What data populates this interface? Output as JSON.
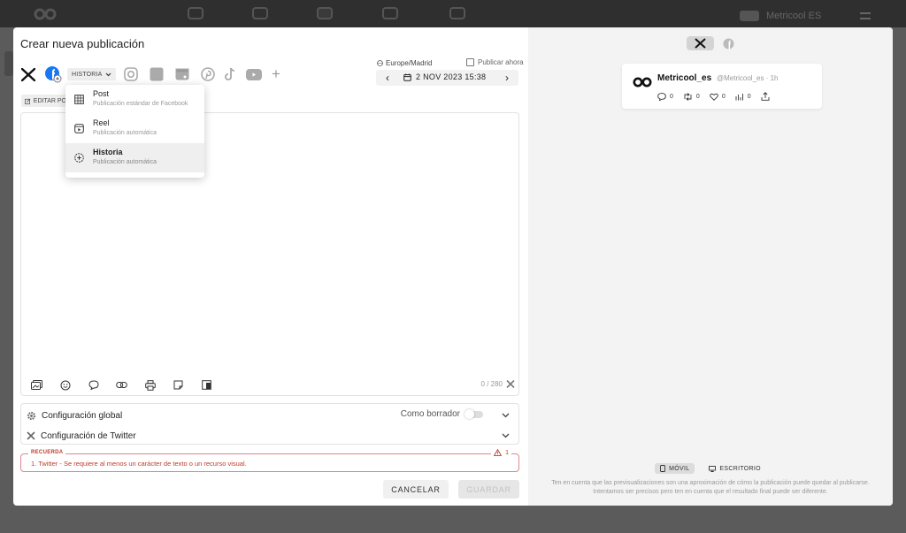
{
  "app": {
    "brand": "Metricool ES"
  },
  "modal": {
    "title": "Crear nueva publicación",
    "post_type": "HISTORIA",
    "timezone": "Europe/Madrid",
    "publish_now": "Publicar ahora",
    "date": "2 NOV 2023 15:38",
    "edit_label": "EDITAR PO",
    "type_options": [
      {
        "title": "Post",
        "subtitle": "Publicación estándar de Facebook",
        "icon": "grid-icon",
        "selected": false
      },
      {
        "title": "Reel",
        "subtitle": "Publicación automática",
        "icon": "reel-icon",
        "selected": false
      },
      {
        "title": "Historia",
        "subtitle": "Publicación automática",
        "icon": "story-icon",
        "selected": true
      }
    ],
    "counter": "0 / 280",
    "config": {
      "global": "Configuración global",
      "draft": "Como borrador",
      "twitter": "Configuración de Twitter"
    },
    "alert": {
      "tag": "RECUERDA",
      "count": "1",
      "message": "1. Twitter - Se requiere al menos un carácter de texto o un recurso visual."
    },
    "buttons": {
      "cancel": "CANCELAR",
      "save": "GUARDAR"
    }
  },
  "preview": {
    "name": "Metricool_es",
    "handle": "@Metricool_es · 1h",
    "stats": {
      "replies": "0",
      "retweets": "0",
      "likes": "0",
      "views": "0"
    },
    "devices": {
      "mobile": "MÓVIL",
      "desktop": "ESCRITORIO"
    },
    "note_line1": "Ten en cuenta que las previsualizaciones son una aproximación de cómo la publicación puede quedar al publicarse.",
    "note_line2": "Intentamos ser precisos pero ten en cuenta que el resultado final puede ser diferente."
  },
  "colors": {
    "alert": "#c0392b",
    "facebook": "#1877f2"
  }
}
